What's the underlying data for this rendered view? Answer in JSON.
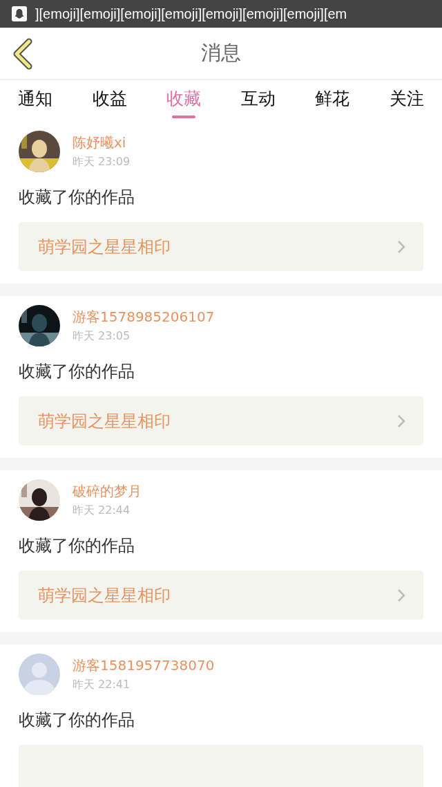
{
  "status_bar": {
    "notification": "][emoji][emoji][emoji][emoji][emoji][emoji][emoji][em"
  },
  "header": {
    "title": "消息"
  },
  "tabs": [
    {
      "label": "通知",
      "selected": false
    },
    {
      "label": "收益",
      "selected": false
    },
    {
      "label": "收藏",
      "selected": true
    },
    {
      "label": "互动",
      "selected": false
    },
    {
      "label": "鲜花",
      "selected": false
    },
    {
      "label": "关注",
      "selected": false
    }
  ],
  "messages": [
    {
      "user": "陈妤曦xi",
      "time": "昨天 23:09",
      "action": "收藏了你的作品",
      "work": "萌学园之星星相印"
    },
    {
      "user": "游客1578985206107",
      "time": "昨天 23:05",
      "action": "收藏了你的作品",
      "work": "萌学园之星星相印"
    },
    {
      "user": "破碎的梦月",
      "time": "昨天 22:44",
      "action": "收藏了你的作品",
      "work": "萌学园之星星相印"
    },
    {
      "avatar": {
        "kind": "default"
      },
      "user": "游客1581957738070",
      "time": "昨天 22:41",
      "action": "收藏了你的作品"
    }
  ]
}
